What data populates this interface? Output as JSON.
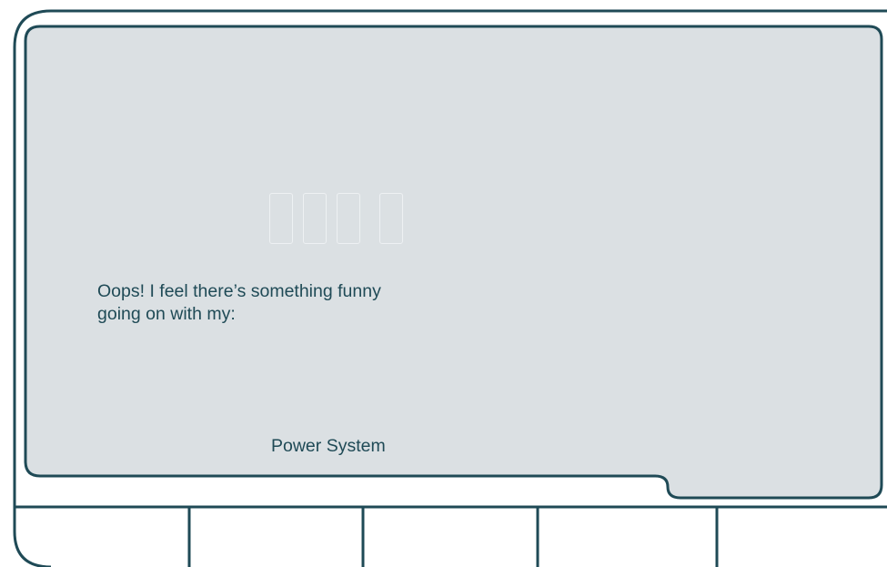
{
  "screen": {
    "message_lines": [
      "Oops! I feel there’s something funny",
      "going on with my:"
    ],
    "subsystem": "Power System",
    "code_display": [
      "",
      "",
      "",
      ""
    ]
  },
  "softkeys": [
    "",
    "",
    "",
    "",
    ""
  ],
  "colors": {
    "outline": "#1f4a56",
    "screen_fill": "#dbe0e3",
    "segment": "#eef1f3",
    "text": "#1f4a56"
  }
}
